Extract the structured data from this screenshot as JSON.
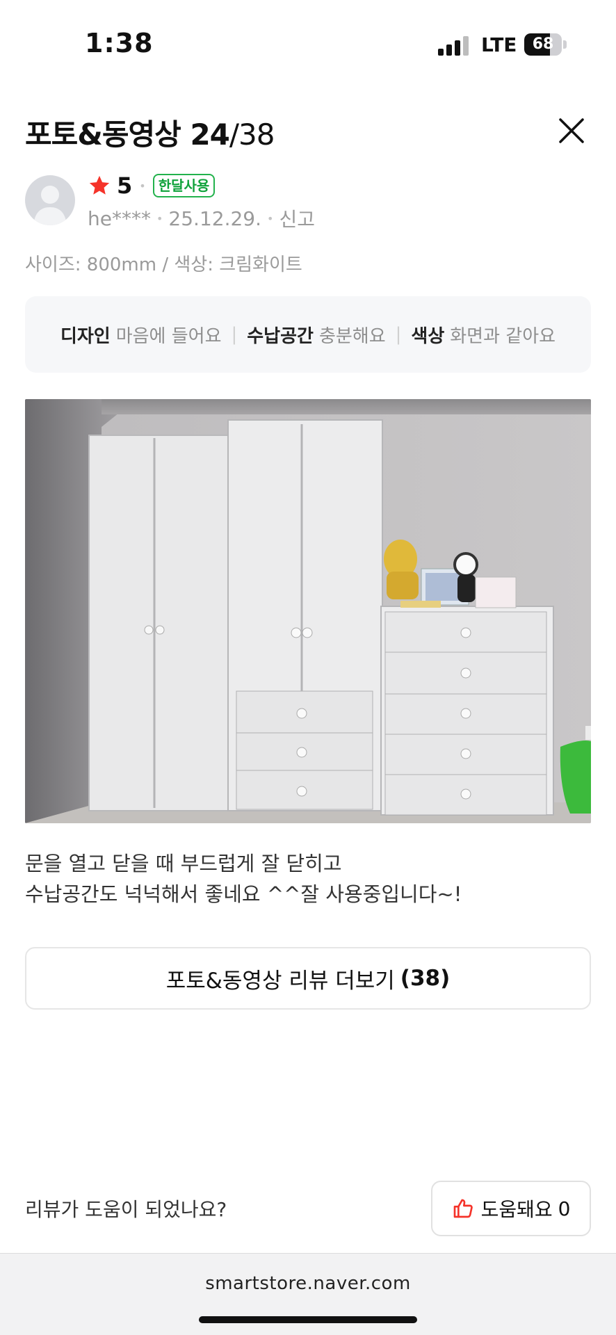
{
  "status_bar": {
    "time": "1:38",
    "network": "LTE",
    "battery": "68",
    "battery_level": 0.68
  },
  "header": {
    "title_prefix": "포토&동영상",
    "current": "24",
    "total": "/38"
  },
  "review": {
    "rating": "5",
    "badge": "한달사용",
    "user": "he****",
    "date": "25.12.29.",
    "report": "신고",
    "options": "사이즈: 800mm / 색상: 크림화이트",
    "attributes": [
      {
        "key": "디자인",
        "value": "마음에 들어요"
      },
      {
        "key": "수납공간",
        "value": "충분해요"
      },
      {
        "key": "색상",
        "value": "화면과 같아요"
      }
    ],
    "text_line1": "문을 열고 닫을 때 부드럽게 잘 닫히고",
    "text_line2": "수납공간도 넉넉해서 좋네요 ^^잘 사용중입니다~!"
  },
  "more_button": {
    "label": "포토&동영상 리뷰 더보기",
    "count": "(38)"
  },
  "helpful": {
    "question": "리뷰가 도움이 되었나요?",
    "label": "도움돼요",
    "count": "0"
  },
  "browser": {
    "url": "smartstore.naver.com"
  },
  "colors": {
    "star": "#f5332a",
    "badge": "#10a23b",
    "thumb": "#f5332a",
    "attr_bg": "#f6f7f9"
  },
  "icons": {
    "close": "close-icon",
    "star": "star-icon",
    "thumb": "thumbs-up-icon",
    "avatar": "user-avatar-icon"
  }
}
